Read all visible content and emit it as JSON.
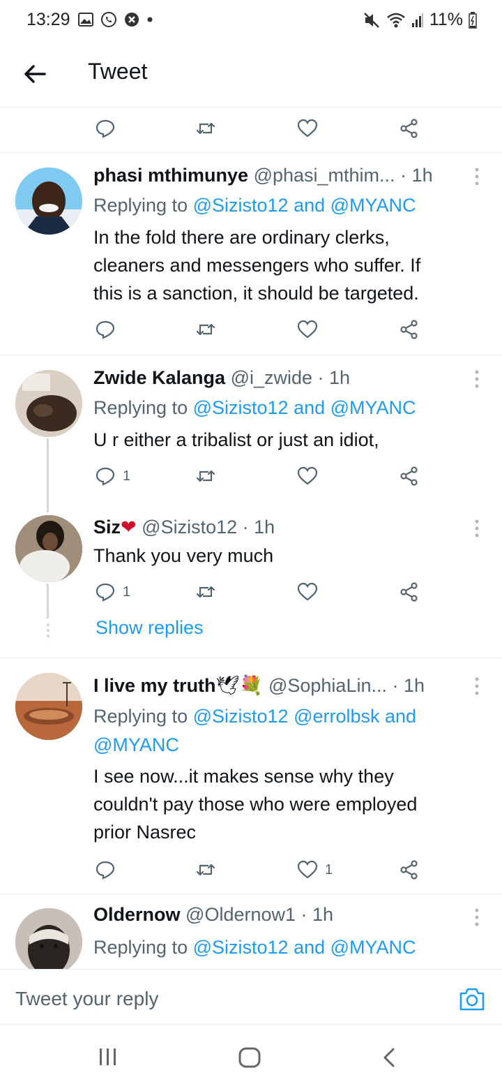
{
  "status_bar": {
    "time": "13:29",
    "battery": "11%",
    "left_icons": [
      "gallery-icon",
      "whatsapp-icon",
      "shield-icon",
      "dot-icon"
    ],
    "right_icons": [
      "mute-icon",
      "wifi-icon",
      "signal-icon",
      "battery-icon"
    ]
  },
  "header": {
    "back_icon": "arrow-left-icon",
    "title": "Tweet"
  },
  "top_actions": {
    "reply": "",
    "retweet": "",
    "like": "",
    "share": ""
  },
  "tweets": [
    {
      "name": "phasi mthimunye",
      "handle": "@phasi_mthim...",
      "time": "· 1h",
      "replying_prefix": "Replying to",
      "mentions": "@Sizisto12 and @MYANC",
      "text_lines": [
        "In the fold there are ordinary clerks,",
        "cleaners and messengers who suffer. If",
        "this is a sanction, it should be targeted."
      ],
      "reply_count": "",
      "like_count": ""
    },
    {
      "name": "Zwide Kalanga",
      "handle": "@i_zwide",
      "time": "· 1h",
      "replying_prefix": "Replying to",
      "mentions": "@Sizisto12 and @MYANC",
      "text_lines": [
        "U r either a tribalist or just an idiot,"
      ],
      "reply_count": "1",
      "like_count": ""
    },
    {
      "name": "Siz",
      "name_emoji": "❤",
      "handle": "@Sizisto12",
      "time": "· 1h",
      "text_lines": [
        "Thank you very much"
      ],
      "reply_count": "1",
      "like_count": ""
    },
    {
      "name": "I live my truth",
      "name_emoji": "🕊💐",
      "handle": "@SophiaLin...",
      "time": "· 1h",
      "replying_prefix": "Replying to",
      "mentions_lines": [
        "@Sizisto12 @errolbsk and",
        "@MYANC"
      ],
      "text_lines": [
        "I see now...it makes sense why they",
        "couldn't pay those who were employed",
        "prior Nasrec"
      ],
      "reply_count": "",
      "like_count": "1"
    },
    {
      "name": "Oldernow",
      "handle": "@Oldernow1",
      "time": "· 1h",
      "replying_prefix": "Replying to",
      "mentions": "@Sizisto12 and @MYANC"
    }
  ],
  "show_replies": "Show replies",
  "composer": {
    "placeholder": "Tweet your reply",
    "camera_icon": "camera-icon"
  },
  "nav": {
    "recents_icon": "recents-icon",
    "home_icon": "home-icon",
    "back_icon": "nav-back-icon"
  },
  "colors": {
    "accent": "#1d9bf0",
    "text": "#0f1419",
    "muted": "#536471",
    "divider": "#e6ecf0"
  }
}
